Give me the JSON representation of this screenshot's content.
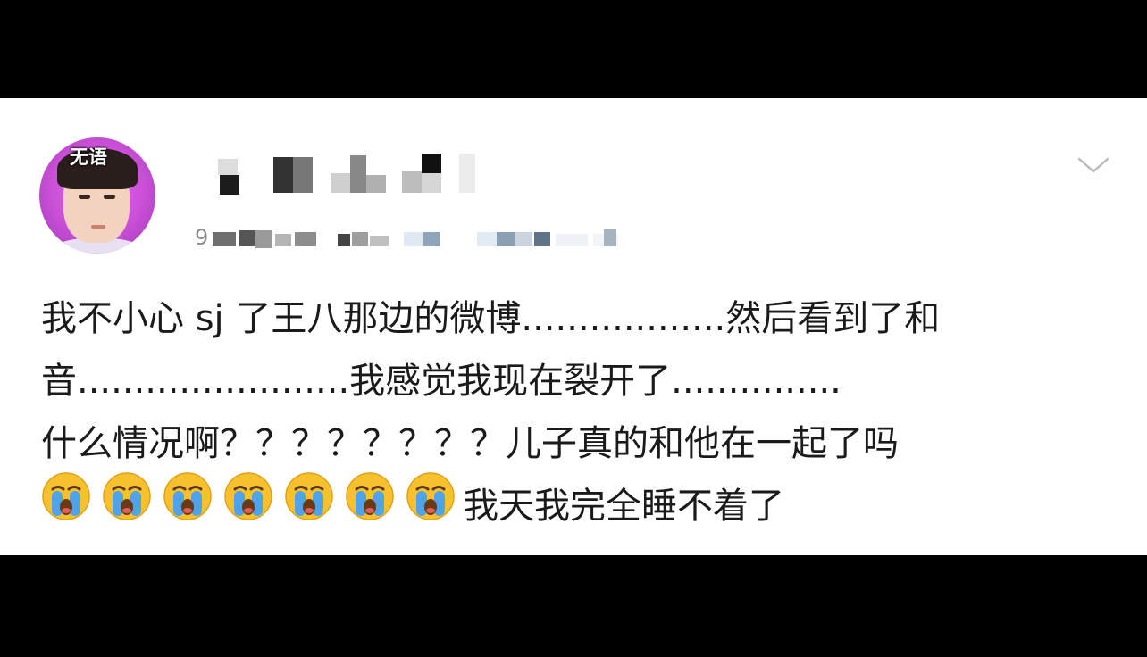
{
  "post": {
    "avatar_tag": "无语",
    "meta_prefix": "9",
    "lines": [
      "我不小心 sj 了王八那边的微博..................然后看到了和",
      "音........................我感觉我现在裂开了...............",
      "什么情况啊？？？？？？？？儿子真的和他在一起了吗"
    ],
    "emoji_count": 7,
    "emoji_icon": "loudly-crying-face",
    "last_line_text": "我天我完全睡不着了"
  },
  "colors": {
    "background": "#000000",
    "card": "#ffffff",
    "text": "#1a1a1a",
    "avatar_bg": "#c84fd6",
    "emoji_face": "#f7c12e",
    "emoji_tears": "#4fa3e8"
  }
}
